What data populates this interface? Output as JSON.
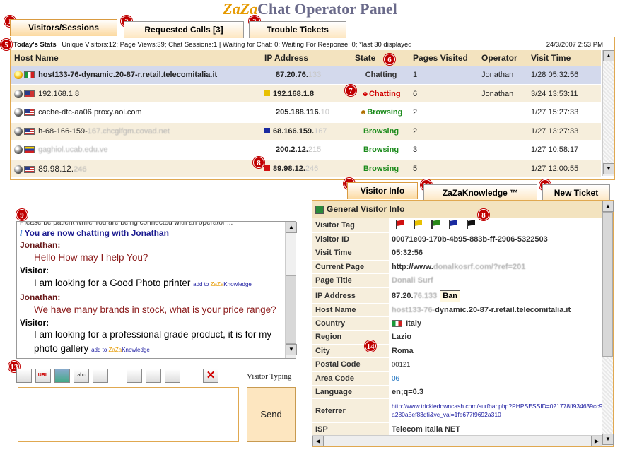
{
  "header": {
    "brand": "ZaZa",
    "title": "Chat Operator Panel"
  },
  "top_tabs": [
    {
      "label": "Visitors/Sessions",
      "badge": "1"
    },
    {
      "label": "Requested Calls [3]",
      "badge": "2"
    },
    {
      "label": "Trouble Tickets",
      "badge": "3"
    }
  ],
  "stats": {
    "badge": "5",
    "label": "Today's Stats",
    "text": " | Unique Visitors:12; Page Views:39; Chat Sessions:1 | Waiting for Chat: 0; Waiting For Response: 0;  *last 30 displayed",
    "datetime": "24/3/2007 2:53 PM"
  },
  "visitors_table": {
    "columns": [
      "Host Name",
      "IP Address",
      "State",
      "Pages Visited",
      "Operator",
      "Visit Time"
    ],
    "state_badge": "6",
    "rows": [
      {
        "host": "host133-76-dynamic.20-87-r.retail.telecomitalia.it",
        "ip": "87.20.76.",
        "ip_blur": "133",
        "state": "Chatting",
        "pages": "1",
        "operator": "Jonathan",
        "time": "1/28 05:32:56",
        "flag": "it",
        "icon": "smile"
      },
      {
        "host": "192.168.1.8",
        "ip": "192.168.1.8",
        "ip_blur": "",
        "state": "Chatting",
        "pages": "6",
        "operator": "Jonathan",
        "time": "3/24 13:53:11",
        "flag": "us",
        "icon": "dot"
      },
      {
        "host": "cache-dtc-aa06.proxy.aol.com",
        "ip": "205.188.116.",
        "ip_blur": "10",
        "state": "Browsing",
        "pages": "2",
        "operator": "",
        "time": "1/27 15:27:33",
        "flag": "us",
        "icon": "dot"
      },
      {
        "host": "h-68-166-159-",
        "host_blur": "167.chcglfgm.covad.net",
        "ip": "68.166.159.",
        "ip_blur": "167",
        "state": "Browsing",
        "pages": "2",
        "operator": "",
        "time": "1/27 13:27:33",
        "flag": "us",
        "icon": "dot"
      },
      {
        "host": "",
        "host_blur": "gaghiol.ucab.edu.ve",
        "ip": "200.2.12.",
        "ip_blur": "215",
        "state": "Browsing",
        "pages": "3",
        "operator": "",
        "time": "1/27 10:58:17",
        "flag": "ve",
        "icon": "dot"
      },
      {
        "host": "89.98.12.",
        "host_blur": "246",
        "ip": "89.98.12.",
        "ip_blur": "246",
        "state": "Browsing",
        "pages": "5",
        "operator": "",
        "time": "1/27 12:00:55",
        "flag": "us",
        "icon": "dot"
      }
    ],
    "badge7": "7",
    "badge8": "8"
  },
  "chat": {
    "badge": "9",
    "partial_line": "Please be patient while You are being connected with an operator ...",
    "info_line": "You are now chatting with Jonathan",
    "messages": [
      {
        "who": "Jonathan:",
        "text": "Hello How may I help You?",
        "kind": "op",
        "kb": ""
      },
      {
        "who": "Visitor:",
        "text": "I am looking for a Good Photo printer",
        "kind": "vis",
        "kb": "add to ZaZaKnowledge"
      },
      {
        "who": "Jonathan:",
        "text": "We have many brands in stock, what is your price range?",
        "kind": "op",
        "kb": ""
      },
      {
        "who": "Visitor:",
        "text": "I am looking for a professional grade product, it is for my photo gallery",
        "kind": "vis",
        "kb": "add to ZaZaKnowledge"
      }
    ],
    "kb_prefix": "add to ",
    "kb_brand": "ZaZa",
    "kb_suffix": "Knowledge",
    "toolbar_badge": "13",
    "typing_status": "Visitor Typing",
    "send_label": "Send"
  },
  "info_tabs": [
    {
      "label": "Visitor Info",
      "badge": "10"
    },
    {
      "label": "ZaZaKnowledge ™",
      "badge": "11"
    },
    {
      "label": "New Ticket",
      "badge": "12"
    }
  ],
  "visitor_info": {
    "title": "General Visitor Info",
    "tag_badge": "8",
    "region_badge": "14",
    "tag_colors": [
      "#d01010",
      "#e8c000",
      "#2a8a1a",
      "#1a2aa0",
      "#111111"
    ],
    "rows": [
      {
        "label": "Visitor Tag",
        "value": ""
      },
      {
        "label": "Visitor ID",
        "value": "00071e09-170b-4b95-883b-ff-2906-5322503"
      },
      {
        "label": "Visit Time",
        "value": "05:32:56"
      },
      {
        "label": "Current Page",
        "value": "http://www.",
        "blur": "donalkosrf.com/?ref=201"
      },
      {
        "label": "Page Title",
        "value": "",
        "blur": "Donali Surf"
      },
      {
        "label": "IP Address",
        "value": "87.20.",
        "blur": "76.133",
        "ban": "Ban"
      },
      {
        "label": "Host Name",
        "value": "",
        "blur": "host133-76-",
        "value2": "dynamic.20-87-r.retail.telecomitalia.it"
      },
      {
        "label": "Country",
        "value": "Italy"
      },
      {
        "label": "Region",
        "value": "Lazio"
      },
      {
        "label": "City",
        "value": "Roma"
      },
      {
        "label": "Postal Code",
        "value": "00121"
      },
      {
        "label": "Area Code",
        "value": "06"
      },
      {
        "label": "Language",
        "value": "en;q=0.3"
      },
      {
        "label": "Referrer",
        "value": "http://www.trickledowncash.com/surfbar.php?PHPSESSID=021778ff934639cc991da280a5ef83dfi&vc_val=1fe677f9692a310"
      },
      {
        "label": "ISP",
        "value": "Telecom Italia NET"
      }
    ]
  },
  "colors": {
    "accent": "#e69a00",
    "badge": "#c00000",
    "tab_bg": "#fde6c0",
    "header_bg": "#f3e3bf"
  }
}
